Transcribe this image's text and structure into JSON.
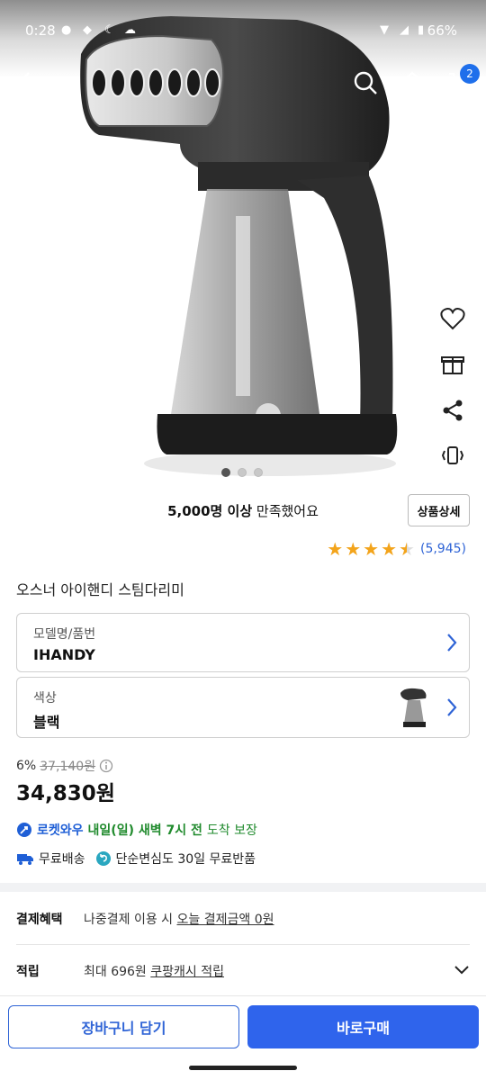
{
  "status_bar": {
    "time": "0:28",
    "battery": "66%"
  },
  "header": {
    "cart_count": "2"
  },
  "gallery": {
    "page_count": 3,
    "active_index": 0
  },
  "summary": {
    "sold_bold": "5,000명 이상",
    "sold_rest": " 만족했어요",
    "detail_button": "상품상세",
    "rating_value": 4.5,
    "review_count": "(5,945)"
  },
  "product": {
    "title": "오스너 아이핸디 스팀다리미"
  },
  "options": [
    {
      "label": "모델명/품번",
      "value": "IHANDY"
    },
    {
      "label": "색상",
      "value": "블랙"
    }
  ],
  "pricing": {
    "discount_rate": "6%",
    "original_price": "37,140원",
    "price": "34,830원"
  },
  "delivery": {
    "brand": "로켓와우",
    "eta": "내일(일) 새벽 7시 전",
    "guarantee": "도착 보장",
    "free_shipping": "무료배송",
    "returns": "단순변심도 30일 무료반품"
  },
  "benefits": [
    {
      "key": "결제혜택",
      "pre": "나중결제 이용 시 ",
      "link": "오늘 결제금액 0원"
    },
    {
      "key": "적립",
      "pre": "최대 696원 ",
      "link": "쿠팡캐시 적립"
    }
  ],
  "actions": {
    "add_to_cart": "장바구니 담기",
    "buy_now": "바로구매"
  },
  "colors": {
    "accent": "#2f64ec",
    "rocket_blue": "#1f5fd6",
    "eta_green": "#1f8a2c",
    "star": "#f3a41b"
  }
}
